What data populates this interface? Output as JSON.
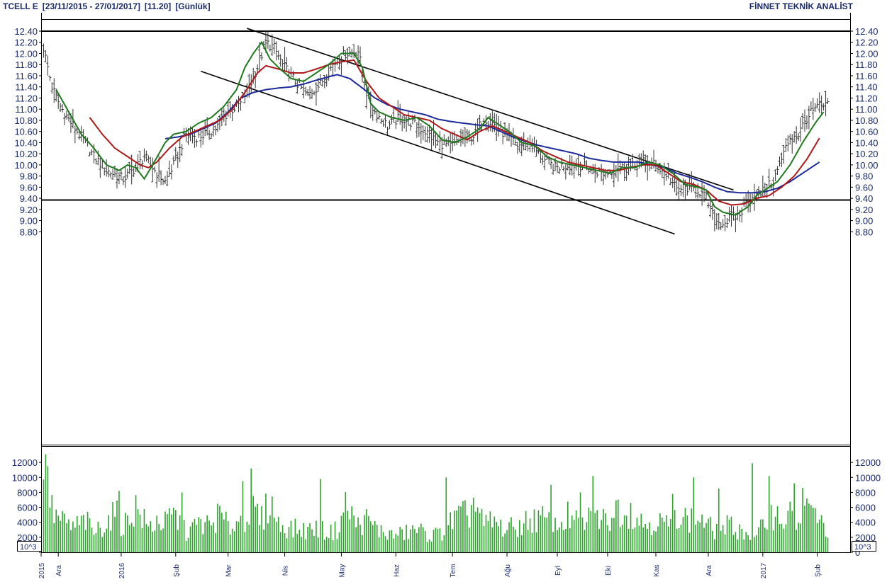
{
  "header": {
    "symbol": "TCELL E",
    "date_range": "[23/11/2015 - 27/01/2017]",
    "last_price": "[11.20]",
    "period": "[Günlük]",
    "brand": "FİNNET TEKNİK ANALİST"
  },
  "colors": {
    "price_bars": "#333333",
    "ma_short": "#1f7a1f",
    "ma_mid": "#b01818",
    "ma_long": "#1c2a9c",
    "volume": "#2aa52a",
    "axis_text": "#1a2a6c",
    "lines": "#000000"
  },
  "chart_data": [
    {
      "type": "line",
      "name": "price",
      "ylim": [
        8.7,
        12.55
      ],
      "y_ticks": [
        "12.40",
        "12.20",
        "12.00",
        "11.80",
        "11.60",
        "11.40",
        "11.20",
        "11.00",
        "10.80",
        "10.60",
        "10.40",
        "10.20",
        "10.00",
        "9.80",
        "9.60",
        "9.40",
        "9.20",
        "9.00",
        "8.80"
      ],
      "x_labels": [
        "2015",
        "Ara",
        "2016",
        "Şub",
        "Mar",
        "Nis",
        "May",
        "Haz",
        "Tem",
        "Ağu",
        "Eyl",
        "Eki",
        "Kas",
        "Ara",
        "2017",
        "Şub"
      ],
      "close_key": [
        [
          0,
          12.1
        ],
        [
          4,
          11.4
        ],
        [
          8,
          11.05
        ],
        [
          14,
          10.7
        ],
        [
          20,
          10.4
        ],
        [
          24,
          10.15
        ],
        [
          30,
          9.9
        ],
        [
          38,
          9.75
        ],
        [
          44,
          9.95
        ],
        [
          48,
          10.15
        ],
        [
          54,
          9.85
        ],
        [
          58,
          9.7
        ],
        [
          62,
          10.0
        ],
        [
          68,
          10.55
        ],
        [
          74,
          10.5
        ],
        [
          82,
          10.65
        ],
        [
          88,
          10.95
        ],
        [
          94,
          11.1
        ],
        [
          98,
          11.4
        ],
        [
          102,
          11.75
        ],
        [
          106,
          12.2
        ],
        [
          110,
          12.1
        ],
        [
          114,
          11.8
        ],
        [
          120,
          11.5
        ],
        [
          126,
          11.25
        ],
        [
          132,
          11.45
        ],
        [
          138,
          11.8
        ],
        [
          144,
          12.0
        ],
        [
          150,
          12.05
        ],
        [
          154,
          11.3
        ],
        [
          158,
          10.95
        ],
        [
          164,
          10.7
        ],
        [
          170,
          10.85
        ],
        [
          176,
          10.75
        ],
        [
          182,
          10.6
        ],
        [
          188,
          10.4
        ],
        [
          194,
          10.35
        ],
        [
          200,
          10.45
        ],
        [
          206,
          10.55
        ],
        [
          210,
          10.85
        ],
        [
          214,
          10.75
        ],
        [
          220,
          10.55
        ],
        [
          226,
          10.35
        ],
        [
          232,
          10.4
        ],
        [
          238,
          10.1
        ],
        [
          244,
          9.95
        ],
        [
          250,
          10.0
        ],
        [
          256,
          10.0
        ],
        [
          262,
          9.9
        ],
        [
          268,
          9.85
        ],
        [
          274,
          9.95
        ],
        [
          280,
          9.95
        ],
        [
          286,
          10.05
        ],
        [
          292,
          10.0
        ],
        [
          298,
          9.8
        ],
        [
          302,
          9.55
        ],
        [
          306,
          9.6
        ],
        [
          312,
          9.55
        ],
        [
          316,
          9.4
        ],
        [
          320,
          9.0
        ],
        [
          324,
          8.95
        ],
        [
          328,
          9.05
        ],
        [
          332,
          9.1
        ],
        [
          336,
          9.4
        ],
        [
          340,
          9.45
        ],
        [
          344,
          9.55
        ],
        [
          348,
          9.7
        ],
        [
          352,
          10.1
        ],
        [
          356,
          10.5
        ],
        [
          360,
          10.55
        ],
        [
          364,
          10.85
        ],
        [
          368,
          11.0
        ],
        [
          370,
          11.05
        ]
      ],
      "ma_short_key": [
        [
          6,
          11.35
        ],
        [
          12,
          10.95
        ],
        [
          18,
          10.55
        ],
        [
          24,
          10.3
        ],
        [
          30,
          10.0
        ],
        [
          36,
          9.9
        ],
        [
          40,
          10.0
        ],
        [
          44,
          9.95
        ],
        [
          48,
          9.75
        ],
        [
          52,
          10.0
        ],
        [
          58,
          10.4
        ],
        [
          62,
          10.55
        ],
        [
          68,
          10.6
        ],
        [
          74,
          10.75
        ],
        [
          80,
          10.85
        ],
        [
          86,
          11.05
        ],
        [
          92,
          11.35
        ],
        [
          96,
          11.75
        ],
        [
          100,
          12.0
        ],
        [
          104,
          12.2
        ],
        [
          108,
          11.9
        ],
        [
          112,
          11.75
        ],
        [
          118,
          11.55
        ],
        [
          124,
          11.5
        ],
        [
          130,
          11.65
        ],
        [
          136,
          11.8
        ],
        [
          142,
          12.0
        ],
        [
          148,
          12.0
        ],
        [
          152,
          11.75
        ],
        [
          156,
          11.1
        ],
        [
          160,
          10.95
        ],
        [
          166,
          10.85
        ],
        [
          172,
          10.8
        ],
        [
          178,
          10.85
        ],
        [
          184,
          10.7
        ],
        [
          190,
          10.45
        ],
        [
          196,
          10.4
        ],
        [
          202,
          10.5
        ],
        [
          208,
          10.65
        ],
        [
          212,
          10.85
        ],
        [
          216,
          10.75
        ],
        [
          222,
          10.6
        ],
        [
          228,
          10.4
        ],
        [
          234,
          10.35
        ],
        [
          240,
          10.15
        ],
        [
          246,
          10.05
        ],
        [
          252,
          10.0
        ],
        [
          258,
          9.95
        ],
        [
          264,
          9.9
        ],
        [
          270,
          9.85
        ],
        [
          276,
          9.95
        ],
        [
          282,
          9.95
        ],
        [
          288,
          10.05
        ],
        [
          294,
          10.0
        ],
        [
          300,
          9.85
        ],
        [
          306,
          9.65
        ],
        [
          312,
          9.6
        ],
        [
          316,
          9.55
        ],
        [
          320,
          9.25
        ],
        [
          324,
          9.15
        ],
        [
          330,
          9.1
        ],
        [
          336,
          9.25
        ],
        [
          340,
          9.45
        ],
        [
          344,
          9.55
        ],
        [
          350,
          9.7
        ],
        [
          356,
          10.0
        ],
        [
          362,
          10.4
        ],
        [
          368,
          10.75
        ],
        [
          372,
          10.95
        ]
      ],
      "ma_mid_key": [
        [
          22,
          10.85
        ],
        [
          28,
          10.55
        ],
        [
          34,
          10.3
        ],
        [
          40,
          10.15
        ],
        [
          46,
          10.0
        ],
        [
          50,
          9.95
        ],
        [
          54,
          10.05
        ],
        [
          60,
          10.3
        ],
        [
          66,
          10.5
        ],
        [
          72,
          10.6
        ],
        [
          78,
          10.7
        ],
        [
          84,
          10.8
        ],
        [
          90,
          11.0
        ],
        [
          96,
          11.3
        ],
        [
          102,
          11.65
        ],
        [
          106,
          11.78
        ],
        [
          112,
          11.72
        ],
        [
          118,
          11.65
        ],
        [
          124,
          11.65
        ],
        [
          130,
          11.72
        ],
        [
          136,
          11.8
        ],
        [
          142,
          11.85
        ],
        [
          148,
          11.88
        ],
        [
          154,
          11.5
        ],
        [
          160,
          11.2
        ],
        [
          166,
          11.05
        ],
        [
          172,
          10.9
        ],
        [
          178,
          10.85
        ],
        [
          184,
          10.8
        ],
        [
          190,
          10.65
        ],
        [
          196,
          10.55
        ],
        [
          202,
          10.45
        ],
        [
          208,
          10.6
        ],
        [
          214,
          10.7
        ],
        [
          220,
          10.6
        ],
        [
          226,
          10.5
        ],
        [
          232,
          10.4
        ],
        [
          238,
          10.25
        ],
        [
          244,
          10.15
        ],
        [
          250,
          10.05
        ],
        [
          256,
          10.0
        ],
        [
          262,
          9.95
        ],
        [
          268,
          9.9
        ],
        [
          274,
          9.9
        ],
        [
          280,
          9.95
        ],
        [
          286,
          10.0
        ],
        [
          292,
          10.0
        ],
        [
          298,
          9.85
        ],
        [
          304,
          9.7
        ],
        [
          310,
          9.65
        ],
        [
          316,
          9.55
        ],
        [
          322,
          9.35
        ],
        [
          328,
          9.28
        ],
        [
          334,
          9.3
        ],
        [
          340,
          9.4
        ],
        [
          346,
          9.45
        ],
        [
          352,
          9.6
        ],
        [
          358,
          9.8
        ],
        [
          364,
          10.1
        ],
        [
          370,
          10.48
        ]
      ],
      "ma_long_key": [
        [
          58,
          10.47
        ],
        [
          64,
          10.5
        ],
        [
          70,
          10.55
        ],
        [
          76,
          10.65
        ],
        [
          82,
          10.75
        ],
        [
          88,
          10.95
        ],
        [
          94,
          11.2
        ],
        [
          100,
          11.3
        ],
        [
          106,
          11.35
        ],
        [
          112,
          11.38
        ],
        [
          118,
          11.4
        ],
        [
          124,
          11.45
        ],
        [
          130,
          11.52
        ],
        [
          136,
          11.58
        ],
        [
          140,
          11.62
        ],
        [
          146,
          11.55
        ],
        [
          152,
          11.38
        ],
        [
          158,
          11.2
        ],
        [
          164,
          11.08
        ],
        [
          170,
          11.0
        ],
        [
          176,
          10.95
        ],
        [
          182,
          10.9
        ],
        [
          188,
          10.82
        ],
        [
          194,
          10.78
        ],
        [
          200,
          10.75
        ],
        [
          206,
          10.72
        ],
        [
          212,
          10.7
        ],
        [
          218,
          10.6
        ],
        [
          224,
          10.5
        ],
        [
          230,
          10.42
        ],
        [
          236,
          10.35
        ],
        [
          242,
          10.3
        ],
        [
          248,
          10.25
        ],
        [
          254,
          10.2
        ],
        [
          260,
          10.12
        ],
        [
          266,
          10.08
        ],
        [
          272,
          10.05
        ],
        [
          278,
          10.05
        ],
        [
          284,
          10.05
        ],
        [
          290,
          10.0
        ],
        [
          296,
          9.95
        ],
        [
          302,
          9.85
        ],
        [
          308,
          9.78
        ],
        [
          314,
          9.7
        ],
        [
          320,
          9.6
        ],
        [
          326,
          9.52
        ],
        [
          332,
          9.5
        ],
        [
          338,
          9.5
        ],
        [
          344,
          9.52
        ],
        [
          350,
          9.58
        ],
        [
          356,
          9.7
        ],
        [
          362,
          9.85
        ],
        [
          370,
          10.05
        ]
      ],
      "horizontal_levels": [
        12.4,
        9.37
      ],
      "trend_channel": [
        {
          "from": [
            97,
            12.45
          ],
          "to": [
            329,
            9.55
          ]
        },
        {
          "from": [
            75,
            11.68
          ],
          "to": [
            301,
            8.76
          ]
        }
      ]
    },
    {
      "type": "bar",
      "name": "volume",
      "unit_label": "10^3",
      "ylim": [
        0,
        14000
      ],
      "y_ticks": [
        "12000",
        "10000",
        "8000",
        "6000",
        "4000",
        "2000",
        "0"
      ],
      "volume_key": [
        [
          0,
          11500
        ],
        [
          4,
          5500
        ],
        [
          8,
          4200
        ],
        [
          14,
          3300
        ],
        [
          20,
          4200
        ],
        [
          24,
          2600
        ],
        [
          30,
          4000
        ],
        [
          34,
          5200
        ],
        [
          38,
          3500
        ],
        [
          44,
          6000
        ],
        [
          50,
          3200
        ],
        [
          54,
          4200
        ],
        [
          58,
          3800
        ],
        [
          62,
          5000
        ],
        [
          68,
          2600
        ],
        [
          74,
          3800
        ],
        [
          80,
          3600
        ],
        [
          84,
          5100
        ],
        [
          88,
          3300
        ],
        [
          92,
          4000
        ],
        [
          96,
          4800
        ],
        [
          100,
          5600
        ],
        [
          104,
          4300
        ],
        [
          108,
          7000
        ],
        [
          112,
          3700
        ],
        [
          118,
          3200
        ],
        [
          124,
          2900
        ],
        [
          130,
          3200
        ],
        [
          136,
          2600
        ],
        [
          140,
          3000
        ],
        [
          144,
          6200
        ],
        [
          150,
          3600
        ],
        [
          154,
          4300
        ],
        [
          160,
          2900
        ],
        [
          166,
          2300
        ],
        [
          172,
          2500
        ],
        [
          178,
          3100
        ],
        [
          184,
          2200
        ],
        [
          190,
          2600
        ],
        [
          196,
          4500
        ],
        [
          202,
          5000
        ],
        [
          206,
          6000
        ],
        [
          210,
          3600
        ],
        [
          214,
          4100
        ],
        [
          220,
          3100
        ],
        [
          226,
          3400
        ],
        [
          232,
          4300
        ],
        [
          238,
          4400
        ],
        [
          244,
          3400
        ],
        [
          250,
          4700
        ],
        [
          256,
          3600
        ],
        [
          262,
          4700
        ],
        [
          268,
          4200
        ],
        [
          274,
          6000
        ],
        [
          280,
          5600
        ],
        [
          286,
          3800
        ],
        [
          292,
          4200
        ],
        [
          298,
          3600
        ],
        [
          302,
          5700
        ],
        [
          308,
          4100
        ],
        [
          312,
          4600
        ],
        [
          318,
          3300
        ],
        [
          322,
          2600
        ],
        [
          326,
          3500
        ],
        [
          330,
          3200
        ],
        [
          336,
          2500
        ],
        [
          340,
          2000
        ],
        [
          344,
          4100
        ],
        [
          348,
          5300
        ],
        [
          352,
          4500
        ],
        [
          356,
          4800
        ],
        [
          360,
          3700
        ],
        [
          364,
          5500
        ],
        [
          368,
          5300
        ],
        [
          372,
          3200
        ]
      ],
      "volume_spikes": [
        [
          2,
          11500
        ],
        [
          36,
          8200
        ],
        [
          66,
          8000
        ],
        [
          95,
          9500
        ],
        [
          99,
          11200
        ],
        [
          132,
          9800
        ],
        [
          192,
          10000
        ],
        [
          205,
          7300
        ],
        [
          242,
          9000
        ],
        [
          256,
          8000
        ],
        [
          262,
          10200
        ],
        [
          300,
          7800
        ],
        [
          310,
          10000
        ],
        [
          322,
          8500
        ],
        [
          338,
          11900
        ],
        [
          346,
          10200
        ],
        [
          358,
          9200
        ],
        [
          362,
          8600
        ],
        [
          366,
          6300
        ]
      ]
    }
  ]
}
